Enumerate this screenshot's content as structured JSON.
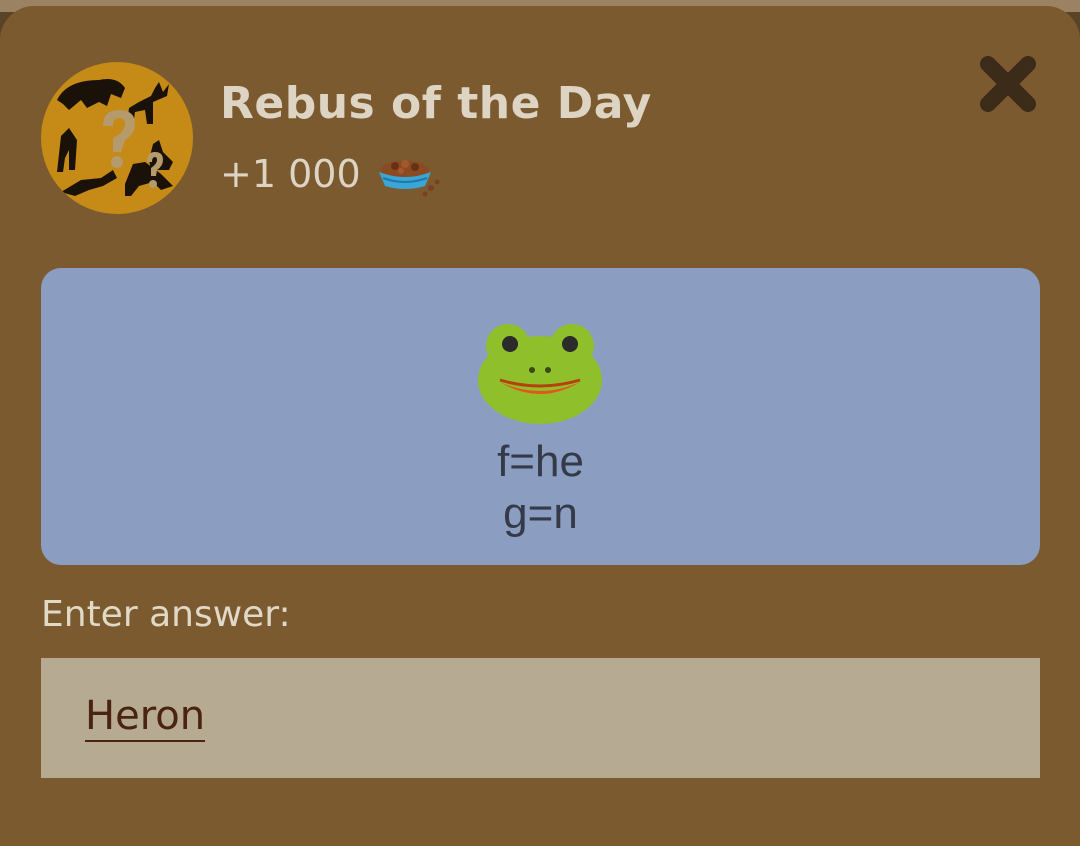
{
  "dialog": {
    "title": "Rebus of the Day",
    "reward_amount": "+1 000",
    "reward_icon": "pet-food-bowl-icon",
    "avatar_icon": "animal-silhouettes-question-icon",
    "close_icon": "close-x-icon"
  },
  "rebus": {
    "emoji_icon": "frog-face-icon",
    "clues": [
      "f=he",
      "g=n"
    ]
  },
  "answer": {
    "label": "Enter answer:",
    "value": "Heron"
  },
  "colors": {
    "modal_background": "#7b5a2f",
    "card_background": "#8b9dc1",
    "input_background": "#b6aa92",
    "avatar_background": "#c68a17",
    "text_light": "#ddd4c3",
    "answer_text": "#4a2410"
  }
}
